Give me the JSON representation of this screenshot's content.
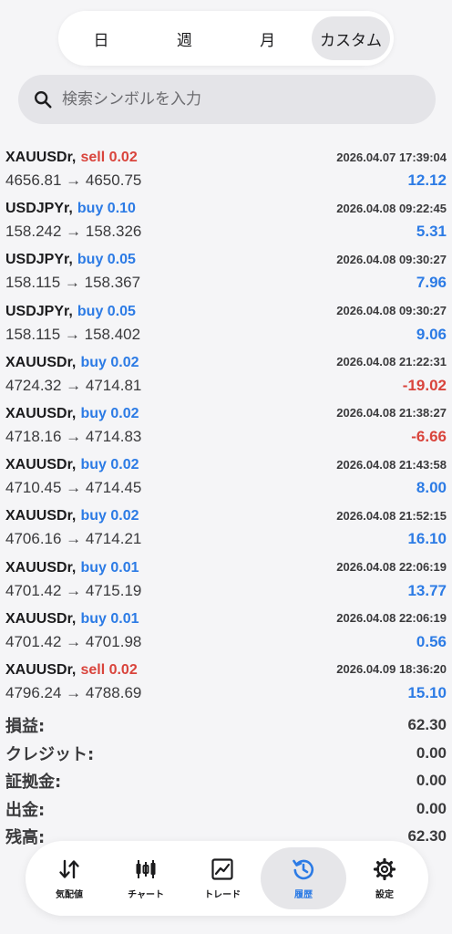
{
  "periods": [
    "日",
    "週",
    "月",
    "カスタム"
  ],
  "search": {
    "placeholder": "検索シンボルを入力"
  },
  "deals": [
    {
      "symbol": "XAUUSDr,",
      "side": "sell 0.02",
      "type": "sell",
      "time": "2026.04.07 17:39:04",
      "prices": "4656.81 → 4650.75",
      "profit": "12.12",
      "sign": "pos"
    },
    {
      "symbol": "USDJPYr,",
      "side": "buy 0.10",
      "type": "buy",
      "time": "2026.04.08 09:22:45",
      "prices": "158.242 → 158.326",
      "profit": "5.31",
      "sign": "pos"
    },
    {
      "symbol": "USDJPYr,",
      "side": "buy 0.05",
      "type": "buy",
      "time": "2026.04.08 09:30:27",
      "prices": "158.115 → 158.367",
      "profit": "7.96",
      "sign": "pos"
    },
    {
      "symbol": "USDJPYr,",
      "side": "buy 0.05",
      "type": "buy",
      "time": "2026.04.08 09:30:27",
      "prices": "158.115 → 158.402",
      "profit": "9.06",
      "sign": "pos"
    },
    {
      "symbol": "XAUUSDr,",
      "side": "buy 0.02",
      "type": "buy",
      "time": "2026.04.08 21:22:31",
      "prices": "4724.32 → 4714.81",
      "profit": "-19.02",
      "sign": "neg"
    },
    {
      "symbol": "XAUUSDr,",
      "side": "buy 0.02",
      "type": "buy",
      "time": "2026.04.08 21:38:27",
      "prices": "4718.16 → 4714.83",
      "profit": "-6.66",
      "sign": "neg"
    },
    {
      "symbol": "XAUUSDr,",
      "side": "buy 0.02",
      "type": "buy",
      "time": "2026.04.08 21:43:58",
      "prices": "4710.45 → 4714.45",
      "profit": "8.00",
      "sign": "pos"
    },
    {
      "symbol": "XAUUSDr,",
      "side": "buy 0.02",
      "type": "buy",
      "time": "2026.04.08 21:52:15",
      "prices": "4706.16 → 4714.21",
      "profit": "16.10",
      "sign": "pos"
    },
    {
      "symbol": "XAUUSDr,",
      "side": "buy 0.01",
      "type": "buy",
      "time": "2026.04.08 22:06:19",
      "prices": "4701.42 → 4715.19",
      "profit": "13.77",
      "sign": "pos"
    },
    {
      "symbol": "XAUUSDr,",
      "side": "buy 0.01",
      "type": "buy",
      "time": "2026.04.08 22:06:19",
      "prices": "4701.42 → 4701.98",
      "profit": "0.56",
      "sign": "pos"
    },
    {
      "symbol": "XAUUSDr,",
      "side": "sell 0.02",
      "type": "sell",
      "time": "2026.04.09 18:36:20",
      "prices": "4796.24 → 4788.69",
      "profit": "15.10",
      "sign": "pos"
    }
  ],
  "summary": [
    {
      "label": "損益:",
      "value": "62.30"
    },
    {
      "label": "クレジット:",
      "value": "0.00"
    },
    {
      "label": "証拠金:",
      "value": "0.00"
    },
    {
      "label": "出金:",
      "value": "0.00"
    },
    {
      "label": "残高:",
      "value": "62.30"
    }
  ],
  "tabs": [
    {
      "label": "気配値",
      "icon": "quotes-icon"
    },
    {
      "label": "チャート",
      "icon": "chart-icon"
    },
    {
      "label": "トレード",
      "icon": "trade-icon"
    },
    {
      "label": "履歴",
      "icon": "history-icon"
    },
    {
      "label": "設定",
      "icon": "settings-icon"
    }
  ],
  "colors": {
    "accent": "#2c7be5",
    "negative": "#d9443c"
  }
}
